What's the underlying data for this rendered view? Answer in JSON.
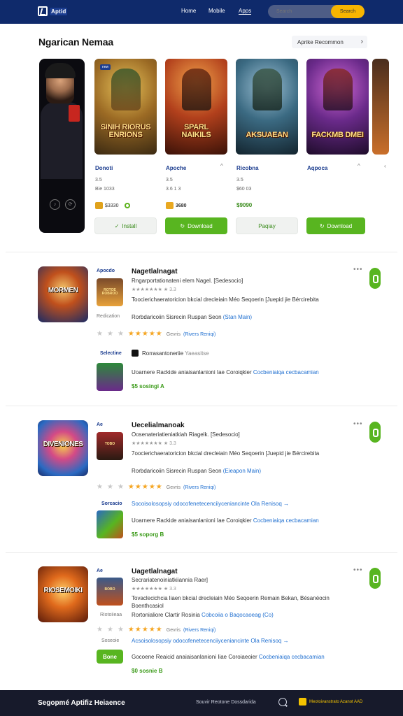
{
  "header": {
    "logo_text": "Aptid",
    "nav": [
      "Home",
      "Mobile",
      "Apps"
    ],
    "search_placeholder": "Search",
    "search_button": "Search"
  },
  "featured": {
    "title": "Ngarican Nemaa",
    "view_all": "Aprike Recommon",
    "cards": [
      {
        "name": "Donoti",
        "meta1": "3.5",
        "meta2": "Bie 1033",
        "price": "$3330",
        "button": "Install",
        "poster": "SINIH RIORUS ENRIONS",
        "badge": "new"
      },
      {
        "name": "Apoche",
        "meta1": "3.5",
        "meta2": "3.6 1 3",
        "price": "3680",
        "button": "Download",
        "poster": "SPARL NAIKILS"
      },
      {
        "name": "Ricobna",
        "meta1": "3.5",
        "meta2": "$60 03",
        "price": "$9090",
        "button": "Paqiay",
        "poster": "AKSUAEAN"
      },
      {
        "name": "Aqpoca",
        "meta1": "",
        "meta2": "",
        "price": "",
        "button": "Download",
        "poster": "FACKMB DMEI"
      }
    ]
  },
  "list": [
    {
      "tag": "Apocdo",
      "label": "Redication",
      "icon_title": "MORMEN",
      "thumb_title": "ROTOE ROBROO",
      "title": "Nagetlalnagat",
      "subtitle": "Rngarportationateni elem Nagel. [Sedesocio]",
      "meta": "3.3",
      "desc1": "Toocierichaeratoricion bkcial drecleiain Méo Seqoerin [Juepid jie Bércirebita",
      "desc2": "Rorbdaricoiin Sisrecin Ruspan Seon",
      "desc2_link": "(Stan Main)",
      "stars_label": "Gevris",
      "stars_link": "(Rivers Reniqi)",
      "link_label": "Selectine",
      "publisher": "Rorrasantoneriie",
      "publisher_suffix": "Yaeasitse",
      "desc3": "Uoarnere Rackide aniaisanlanioni Iae Coroiqkier",
      "desc3_link": "Cocbeniaiqa cecbacamian",
      "price": "$5 sosingi A"
    },
    {
      "tag": "Ae",
      "label": "",
      "icon_title": "DIVENIONES",
      "thumb_title": "TOBO",
      "title": "Uecelialmanoak",
      "subtitle": "Oosenateriatieniatkiah Riagelk. [Sedesocio]",
      "meta": "3.3",
      "desc1": "7oocierichaeratoricion bkcial drecleiain Méo Seqoerin [Juepid jie Bércirebita",
      "desc2": "Rorbdaricoiin Sisrecin Ruspan Seon",
      "desc2_link": "(Eieapon Main)",
      "stars_label": "Gevris",
      "stars_link": "(Rivers Reniqi)",
      "link_label": "Sorcacio",
      "link_line": "Socoisolosopsiy odocofenetecenciiyceniancinte Ola Renisoq →",
      "desc3": "Uoarnere Rackide aniaisanlanioni Iae Coroiqkier",
      "desc3_link": "Cocbeniaiqa cecbacamian",
      "price": "$5 soporg B"
    },
    {
      "tag": "Ae",
      "label": "Riotoiieaa",
      "icon_title": "RIOSEMOIKI",
      "thumb_title": "BOBO",
      "title": "Uagetlalnagat",
      "subtitle": "Secrariatenoiniatkiiannia Raer]",
      "meta": "3.3",
      "desc1": "Tovaclecichcia liaen bkcial drecleiain Méo Seqoerin Remain Bekan, Bésanéocin",
      "desc2": "Boenthcasiol",
      "desc2_mid": "Rortonialiore Clartir Rosinia",
      "desc2_link": "Cobcoiia o Baqocaoeag (Co)",
      "stars_label": "Gevris",
      "stars_link": "(Rivers Reniqi)",
      "link_label": "Soseoie",
      "link_line": "Acsoisolosopsiy odocofenetecenciiyceniancinte Ola Renisoq →",
      "button": "Bone",
      "desc3": "Gocoene Reaicid anaiaisanlanioni Iiae Coroiaeoier",
      "desc3_link": "Cocbeniaiqa cecbacamian",
      "price": "$0 sosnie B"
    }
  ],
  "footer": {
    "brand": "Segopmé Aptifiz Heiaence",
    "links": "Souvir Reotone Dossdarida",
    "right": "Meotoivanstrato Azanot AAD"
  }
}
